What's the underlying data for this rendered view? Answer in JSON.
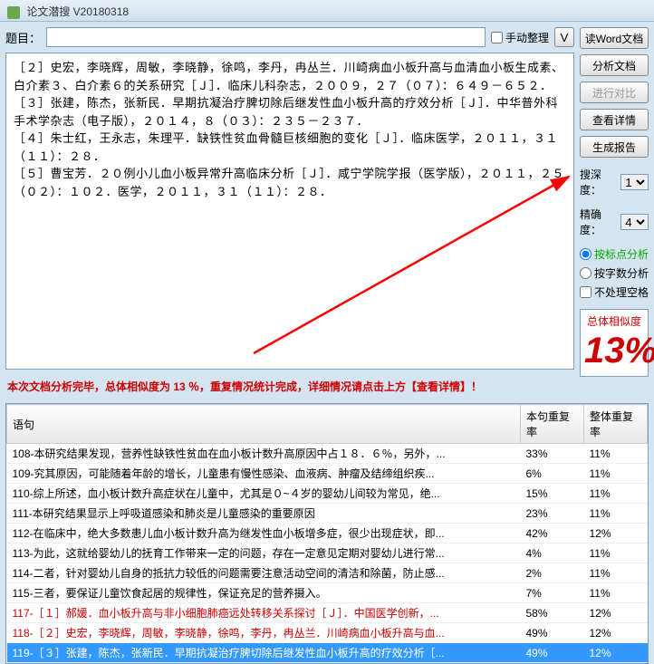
{
  "app_title": "论文潜搜 V20180318",
  "topic_label": "题目：",
  "manual_label": "手动整理",
  "v_button": "V",
  "buttons": {
    "read_word": "读Word文档",
    "analyze": "分析文档",
    "compare": "进行对比",
    "details": "查看详情",
    "report": "生成报告"
  },
  "depth_label": "搜深度：",
  "depth_value": "1",
  "accuracy_label": "精确度：",
  "accuracy_value": "4",
  "radios": {
    "punct": "按标点分析",
    "wordcount": "按字数分析",
    "nospace": "不处理空格"
  },
  "similarity_label": "总体相似度",
  "similarity_value": "13%",
  "text_lines": [
    "［２］史宏，李晓辉，周敏，李晓静，徐鸣，李丹，冉丛兰．川崎病血小板升高与血清血小板生成素、白介素３、白介素６的关系研究［Ｊ］．临床儿科杂志，２００９，２７（０７）：６４９－６５２．",
    "［３］张建，陈杰，张新民．早期抗凝治疗脾切除后继发性血小板升高的疗效分析［Ｊ］．中华普外科手术学杂志（电子版），２０１４，８（０３）：２３５－２３７．",
    "［４］朱士红，王永志，朱理平．缺铁性贫血骨髓巨核细胞的变化［Ｊ］．临床医学，２０１１，３１（１１）：２８．",
    "［５］曹宝芳．２０例小儿血小板异常升高临床分析［Ｊ］．咸宁学院学报（医学版），２０１１，２５（０２）：１０２．医学，２０１１，３１（１１）：２８．"
  ],
  "summary_line": "本次文档分析完毕，总体相似度为 13 ％，重复情况统计完成，详细情况请点击上方【查看详情】！",
  "table": {
    "headers": [
      "语句",
      "本句重复率",
      "整体重复率"
    ],
    "rows": [
      {
        "c": [
          "108-本研究结果发现，营养性缺铁性贫血在血小板计数升高原因中占１８．６％，另外，...",
          "33%",
          "11%"
        ],
        "red": false
      },
      {
        "c": [
          "109-究其原因，可能随着年龄的增长，儿童患有慢性感染、血液病、肿瘤及结缔组织疾...",
          "6%",
          "11%"
        ],
        "red": false
      },
      {
        "c": [
          "110-综上所述，血小板计数升高症状在儿童中，尤其是０~４岁的婴幼儿间较为常见，绝...",
          "15%",
          "11%"
        ],
        "red": false
      },
      {
        "c": [
          "111-本研究结果显示上呼吸道感染和肺炎是儿童感染的重要原因",
          "23%",
          "11%"
        ],
        "red": false
      },
      {
        "c": [
          "112-在临床中，绝大多数患儿血小板计数升高为继发性血小板增多症，很少出现症状，即...",
          "42%",
          "12%"
        ],
        "red": false
      },
      {
        "c": [
          "113-为此，这就给婴幼儿的抚育工作带来一定的问题，存在一定意见定期对婴幼儿进行常...",
          "4%",
          "11%"
        ],
        "red": false
      },
      {
        "c": [
          "114-二者，针对婴幼儿自身的抵抗力较低的问题需要注意活动空间的清洁和除菌，防止感...",
          "2%",
          "11%"
        ],
        "red": false
      },
      {
        "c": [
          "115-三者，要保证儿童饮食起居的规律性，保证充足的营养摄入。",
          "7%",
          "11%"
        ],
        "red": false
      },
      {
        "c": [
          "117-［１］郝媛．血小板升高与非小细胞肺癌远处转移关系探讨［Ｊ］．中国医学创新，...",
          "58%",
          "12%"
        ],
        "red": true
      },
      {
        "c": [
          "118-［２］史宏，李晓辉，周敏，李晓静，徐鸣，李丹，冉丛兰．川崎病血小板升高与血...",
          "49%",
          "12%"
        ],
        "red": true
      },
      {
        "c": [
          "119-［３］张建，陈杰，张新民．早期抗凝治疗脾切除后继发性血小板升高的疗效分析［...",
          "49%",
          "12%"
        ],
        "red": true,
        "sel": true
      }
    ]
  }
}
